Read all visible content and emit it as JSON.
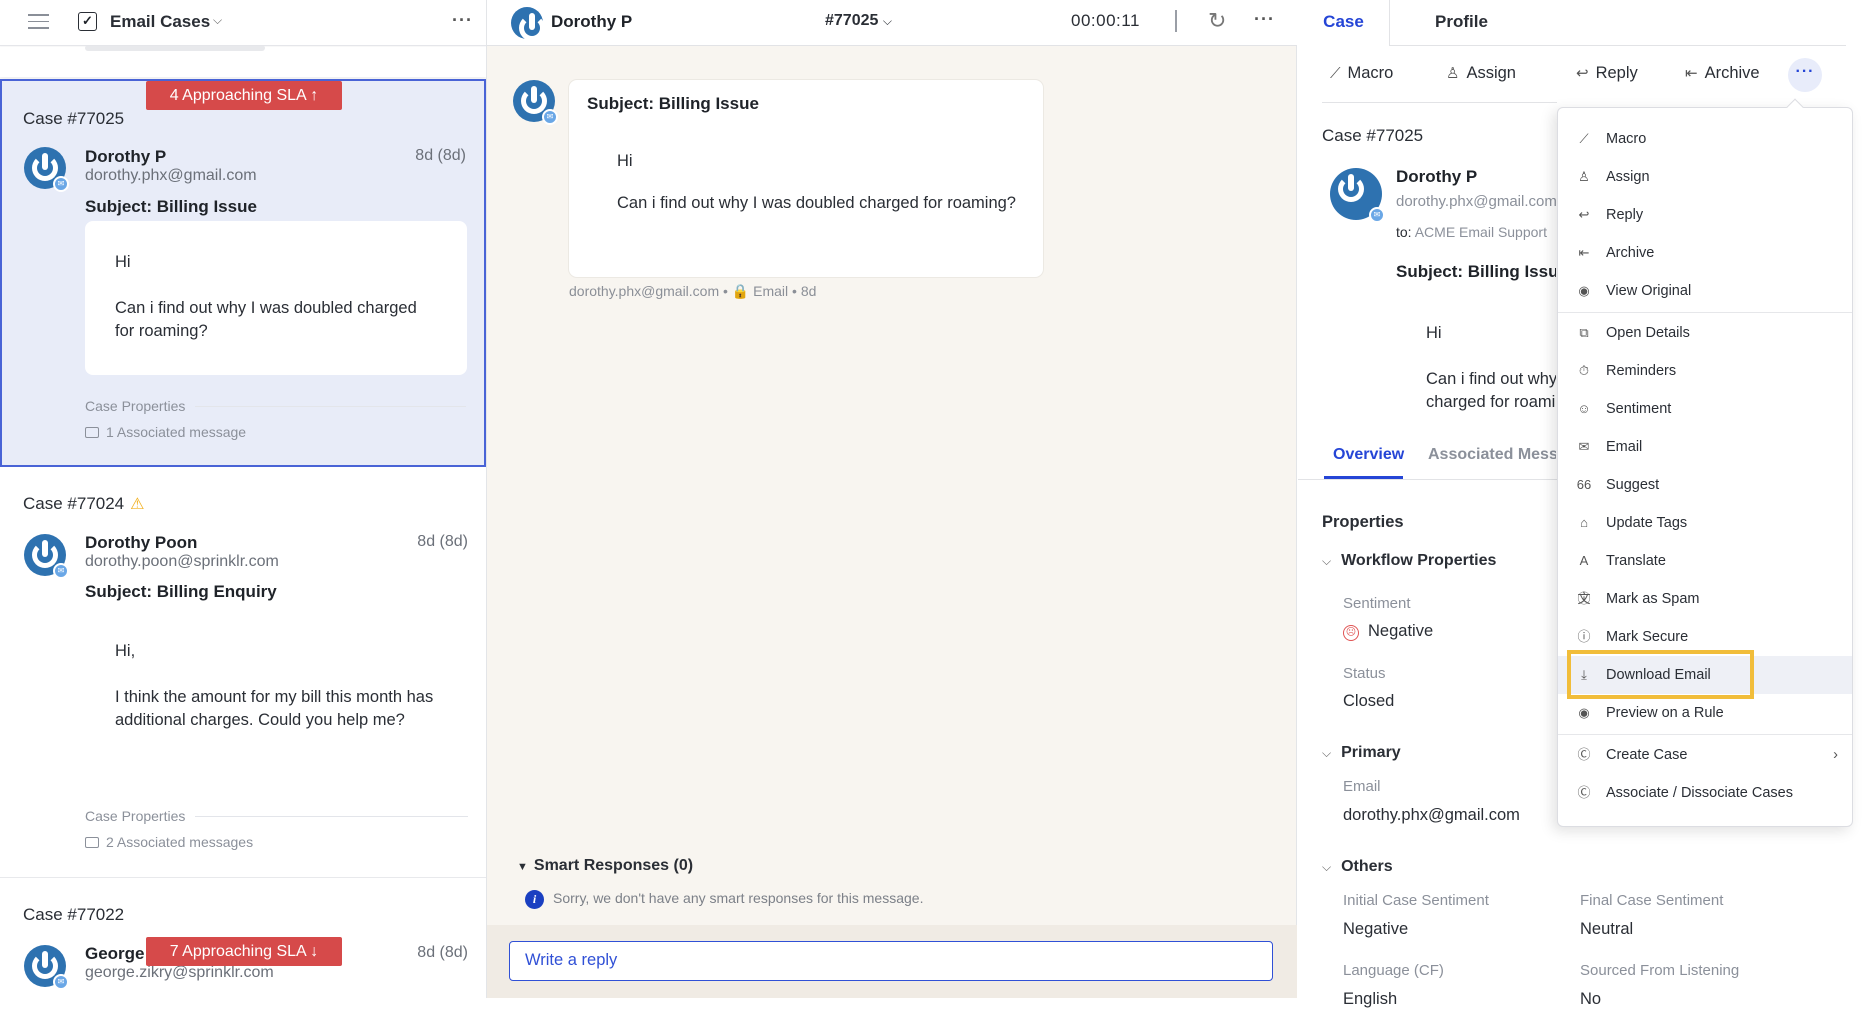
{
  "left_pane": {
    "title": "Email Cases",
    "cases": [
      {
        "case_id": "Case #77025",
        "sla_badge": "4 Approaching SLA ↑",
        "name": "Dorothy P",
        "email": "dorothy.phx@gmail.com",
        "age": "8d (8d)",
        "subject": "Subject: Billing Issue",
        "body_lines": [
          "Hi",
          "Can i find out why I was doubled charged for roaming?"
        ],
        "case_properties_label": "Case Properties",
        "associated": "1 Associated message",
        "selected": true
      },
      {
        "case_id": "Case #77024",
        "warning_icon": "⚠",
        "name": "Dorothy Poon",
        "email": "dorothy.poon@sprinklr.com",
        "age": "8d (8d)",
        "subject": "Subject: Billing Enquiry",
        "body_lines": [
          "Hi,",
          "I think the amount for my bill this month has additional charges. Could you help me?"
        ],
        "case_properties_label": "Case Properties",
        "associated": "2 Associated messages"
      },
      {
        "case_id": "Case #77022",
        "sla_badge": "7 Approaching SLA ↓",
        "name": "George",
        "email": "george.zikry@sprinklr.com",
        "age": "8d (8d)"
      }
    ]
  },
  "conversation": {
    "header": {
      "name": "Dorothy P",
      "case_number": "#77025",
      "timer": "00:00:11"
    },
    "message": {
      "subject": "Subject: Billing Issue",
      "greeting": "Hi",
      "body": "Can i find out why I was doubled charged for roaming?",
      "meta_email": "dorothy.phx@gmail.com",
      "meta_channel": "Email",
      "meta_age": "8d"
    },
    "smart_responses": {
      "title": "Smart Responses (0)",
      "info": "Sorry, we don't have any smart responses for this message."
    },
    "reply_placeholder": "Write a reply"
  },
  "details": {
    "tabs": [
      "Case",
      "Profile"
    ],
    "active_tab": "Case",
    "actions": [
      "Macro",
      "Assign",
      "Reply",
      "Archive"
    ],
    "case_id": "Case #77025",
    "name": "Dorothy P",
    "email": "dorothy.phx@gmail.com",
    "to_label": "to:",
    "to_value": "ACME Email Support",
    "subject": "Subject: Billing Issue",
    "greeting": "Hi",
    "body": "Can i find out why I was doubled charged for roaming?",
    "subtabs": [
      "Overview",
      "Associated Messages"
    ],
    "properties_title": "Properties",
    "workflow": {
      "title": "Workflow Properties",
      "sentiment_label": "Sentiment",
      "sentiment_value": "Negative",
      "status_label": "Status",
      "status_value": "Closed"
    },
    "primary": {
      "title": "Primary",
      "email_label": "Email",
      "email_value": "dorothy.phx@gmail.com"
    },
    "others": {
      "title": "Others",
      "initial_label": "Initial Case Sentiment",
      "initial_value": "Negative",
      "final_label": "Final Case Sentiment",
      "final_value": "Neutral",
      "language_label": "Language (CF)",
      "language_value": "English",
      "sourced_label": "Sourced From Listening",
      "sourced_value": "No"
    }
  },
  "more_menu": {
    "items": [
      {
        "label": "Macro",
        "icon": "magic-wand-icon"
      },
      {
        "label": "Assign",
        "icon": "assign-user-icon"
      },
      {
        "label": "Reply",
        "icon": "reply-icon"
      },
      {
        "label": "Archive",
        "icon": "archive-icon"
      },
      {
        "label": "View Original",
        "icon": "eye-icon"
      },
      {
        "label": "Open Details",
        "icon": "open-details-icon"
      },
      {
        "label": "Reminders",
        "icon": "timer-icon"
      },
      {
        "label": "Sentiment",
        "icon": "sentiment-icon"
      },
      {
        "label": "Email",
        "icon": "email-icon"
      },
      {
        "label": "Suggest",
        "icon": "quote-icon"
      },
      {
        "label": "Update Tags",
        "icon": "tag-icon"
      },
      {
        "label": "Translate",
        "icon": "translate-icon"
      },
      {
        "label": "Mark as Spam",
        "icon": "alert-circle-icon"
      },
      {
        "label": "Mark Secure",
        "icon": "alert-circle-icon"
      },
      {
        "label": "Download Email",
        "icon": "download-icon",
        "highlighted": true
      },
      {
        "label": "Preview on a Rule",
        "icon": "eye-icon"
      },
      {
        "label": "Create Case",
        "icon": "case-icon",
        "has_submenu": true
      },
      {
        "label": "Associate / Dissociate Cases",
        "icon": "case-icon"
      }
    ]
  },
  "colors": {
    "accent": "#2545d6",
    "sla_red": "#d64a4a",
    "highlight": "#f1bd3a",
    "selected_card_bg": "#e8ecf8",
    "avatar_blue": "#2e72b0"
  }
}
